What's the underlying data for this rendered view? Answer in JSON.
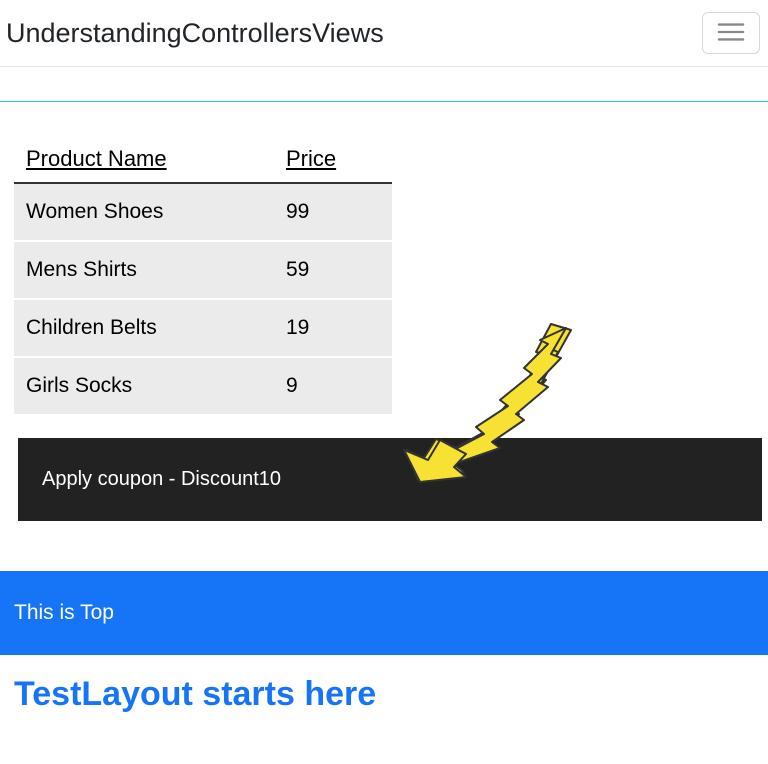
{
  "navbar": {
    "brand": "UnderstandingControllersViews"
  },
  "table": {
    "headers": {
      "product": "Product Name",
      "price": "Price"
    },
    "rows": [
      {
        "name": "Women Shoes",
        "price": "99"
      },
      {
        "name": "Mens Shirts",
        "price": "59"
      },
      {
        "name": "Children Belts",
        "price": "19"
      },
      {
        "name": "Girls Socks",
        "price": "9"
      }
    ]
  },
  "coupon": {
    "text": "Apply coupon - Discount10"
  },
  "topbar": {
    "text": "This is Top"
  },
  "layout": {
    "heading": "TestLayout starts here"
  }
}
